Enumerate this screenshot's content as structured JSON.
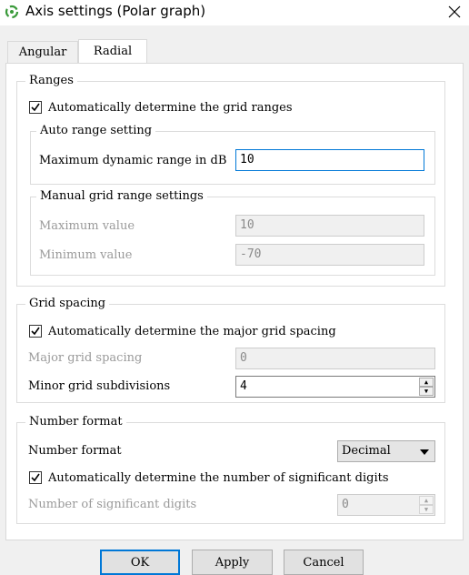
{
  "window": {
    "title": "Axis settings (Polar graph)",
    "close_glyph": "✕"
  },
  "tabs": [
    {
      "label": "Angular",
      "active": false
    },
    {
      "label": "Radial",
      "active": true
    }
  ],
  "ranges": {
    "legend": "Ranges",
    "auto_checkbox_label": "Automatically determine the grid ranges",
    "auto_checked": true,
    "auto_range": {
      "legend": "Auto range setting",
      "max_dynamic_label": "Maximum dynamic range in dB",
      "max_dynamic_value": "10"
    },
    "manual": {
      "legend": "Manual grid range settings",
      "max_label": "Maximum value",
      "max_value": "10",
      "min_label": "Minimum value",
      "min_value": "-70"
    }
  },
  "grid_spacing": {
    "legend": "Grid spacing",
    "auto_checkbox_label": "Automatically determine the major grid spacing",
    "auto_checked": true,
    "major_label": "Major grid spacing",
    "major_value": "0",
    "minor_label": "Minor grid subdivisions",
    "minor_value": "4"
  },
  "number_format": {
    "legend": "Number format",
    "format_label": "Number format",
    "format_value": "Decimal",
    "auto_checkbox_label": "Automatically determine the number of significant digits",
    "auto_checked": true,
    "digits_label": "Number of significant digits",
    "digits_value": "0"
  },
  "buttons": {
    "ok": "OK",
    "apply": "Apply",
    "cancel": "Cancel"
  },
  "colors": {
    "focus_border": "#0078d7",
    "disabled_text": "#9a9a9a",
    "window_bg": "#f0f0f0"
  }
}
